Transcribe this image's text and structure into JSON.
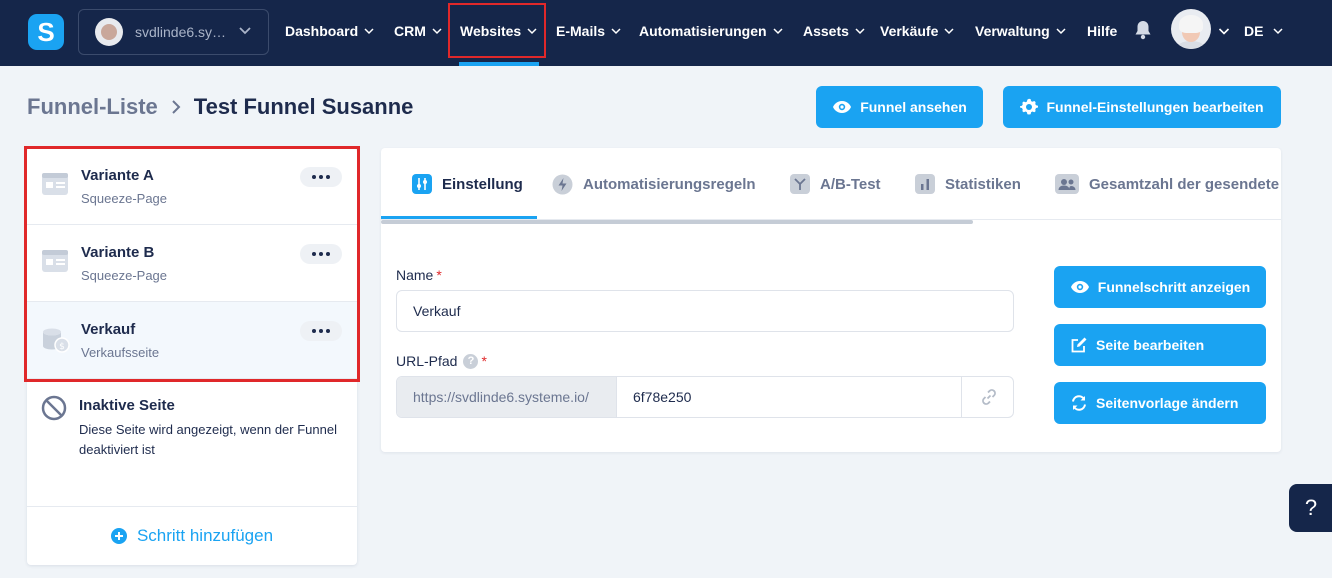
{
  "nav": {
    "logo": "S",
    "account_name": "svdlinde6.sy…",
    "items": [
      {
        "label": "Dashboard"
      },
      {
        "label": "CRM"
      },
      {
        "label": "Websites"
      },
      {
        "label": "E-Mails"
      },
      {
        "label": "Automatisierungen"
      },
      {
        "label": "Assets"
      },
      {
        "label": "Verkäufe"
      },
      {
        "label": "Verwaltung"
      },
      {
        "label": "Hilfe"
      }
    ],
    "active_item": "Websites",
    "language": "DE"
  },
  "breadcrumb": {
    "parent": "Funnel-Liste",
    "current": "Test Funnel Susanne"
  },
  "actions": {
    "view_funnel": "Funnel ansehen",
    "edit_settings": "Funnel-Einstellungen bearbeiten"
  },
  "steps": [
    {
      "title": "Variante A",
      "subtitle": "Squeeze-Page",
      "icon": "page-layout-icon"
    },
    {
      "title": "Variante B",
      "subtitle": "Squeeze-Page",
      "icon": "page-layout-icon"
    },
    {
      "title": "Verkauf",
      "subtitle": "Verkaufsseite",
      "icon": "coins-icon"
    }
  ],
  "inactive_page": {
    "title": "Inaktive Seite",
    "description": "Diese Seite wird angezeigt, wenn der Funnel deaktiviert ist"
  },
  "add_step": "Schritt hinzufügen",
  "tabs": [
    {
      "label": "Einstellung",
      "icon": "sliders-icon"
    },
    {
      "label": "Automatisierungsregeln",
      "icon": "bolt-icon"
    },
    {
      "label": "A/B-Test",
      "icon": "split-icon"
    },
    {
      "label": "Statistiken",
      "icon": "bar-chart-icon"
    },
    {
      "label": "Gesamtzahl der gesendete",
      "icon": "users-icon"
    }
  ],
  "form": {
    "name_label": "Name",
    "name_value": "Verkauf",
    "url_label": "URL-Pfad",
    "url_prefix": "https://svdlinde6.systeme.io/",
    "url_value": "6f78e250",
    "required_mark": "*",
    "help_mark": "?"
  },
  "side_buttons": {
    "show_step": "Funnelschritt anzeigen",
    "edit_page": "Seite bearbeiten",
    "change_template": "Seitenvorlage ändern"
  },
  "help_fab": "?",
  "colors": {
    "nav_bg": "#15264a",
    "accent": "#1aa3f2",
    "highlight": "#e0282a"
  }
}
